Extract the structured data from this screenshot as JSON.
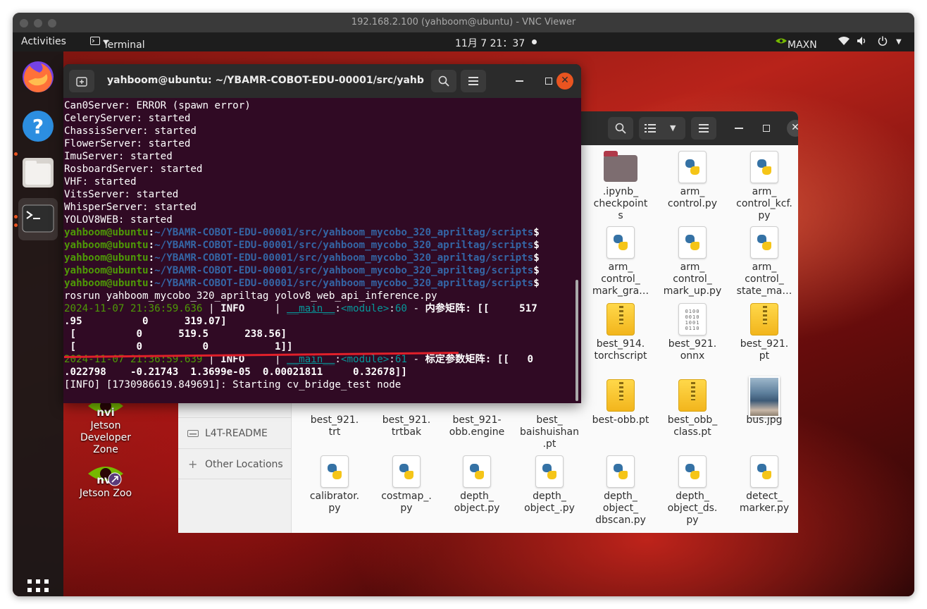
{
  "vnc": {
    "title": "192.168.2.100 (yahboom@ubuntu) - VNC Viewer"
  },
  "topbar": {
    "activities": "Activities",
    "app_name": "Terminal",
    "clock": "11月 7  21：37",
    "power_mode": "MAXN"
  },
  "desktop_icons": [
    {
      "label": "Jetson Developer Zone"
    },
    {
      "label": "Jetson Zoo"
    }
  ],
  "terminal": {
    "title": "yahboom@ubuntu: ~/YBAMR-COBOT-EDU-00001/src/yahboo...",
    "status_lines": [
      "Can0Server: ERROR (spawn error)",
      "CeleryServer: started",
      "ChassisServer: started",
      "FlowerServer: started",
      "ImuServer: started",
      "RosboardServer: started",
      "VHF: started",
      "VitsServer: started",
      "WhisperServer: started",
      "YOLOV8WEB: started"
    ],
    "prompt_user": "yahboom@ubuntu",
    "prompt_path": "~/YBAMR-COBOT-EDU-00001/src/yahboom_mycobo_320_apriltag/scripts",
    "command": "rosrun yahboom_mycobo_320_apriltag yolov8_web_api_inference.py",
    "log1_time": "2024-11-07 21:36:59.636",
    "log1_level": "INFO",
    "log1_module": "__main__",
    "log1_func": "<module>",
    "log1_line": "60",
    "log1_msg": "内参矩阵: [[     517",
    "matrix_rows": [
      ".95          0      319.07]",
      " [          0      519.5      238.56]",
      " [          0          0           1]]"
    ],
    "log2_time": "2024-11-07 21:36:59.639",
    "log2_level": "INFO",
    "log2_module": "__main__",
    "log2_func": "<module>",
    "log2_line": "61",
    "log2_msg": "标定参数矩阵: [[   0",
    "dist_row": ".022798    -0.21743  1.3699e-05  0.00021811     0.32678]]",
    "last_line": "[INFO] [1730986619.849691]: Starting cv_bridge_test node"
  },
  "files": {
    "sidebar": [
      {
        "icon": "drive-icon",
        "label": "L4T-README"
      },
      {
        "icon": "plus-icon",
        "label": "Other Locations"
      }
    ],
    "items": [
      {
        "name": ".ipynb_\ncheckpoint\ns",
        "icon": "folder-icon"
      },
      {
        "name": "arm_\ncontrol.py",
        "icon": "python-file-icon"
      },
      {
        "name": "arm_\ncontrol_kcf.\npy",
        "icon": "python-file-icon"
      },
      {
        "name": "arm_\ncontrol_\nmark_gra…",
        "icon": "python-file-icon"
      },
      {
        "name": "arm_\ncontrol_\nmark_up.py",
        "icon": "python-file-icon"
      },
      {
        "name": "arm_\ncontrol_\nstate_ma…",
        "icon": "python-file-icon"
      },
      {
        "name": "best_914.\ntorchscript",
        "icon": "archive-icon"
      },
      {
        "name": "best_921.\nonnx",
        "icon": "binary-file-icon"
      },
      {
        "name": "best_921.\npt",
        "icon": "archive-icon"
      },
      {
        "name": "best_921.\ntrt",
        "icon": "file-icon"
      },
      {
        "name": "best_921.\ntrtbak",
        "icon": "file-icon"
      },
      {
        "name": "best_921-\nobb.engine",
        "icon": "file-icon"
      },
      {
        "name": "best_\nbaishuishan\n.pt",
        "icon": "archive-icon"
      },
      {
        "name": "best-obb.pt",
        "icon": "archive-icon"
      },
      {
        "name": "best_obb_\nclass.pt",
        "icon": "archive-icon"
      },
      {
        "name": "bus.jpg",
        "icon": "image-file-icon"
      },
      {
        "name": "calibrator.\npy",
        "icon": "python-file-icon"
      },
      {
        "name": "costmap_.\npy",
        "icon": "python-file-icon"
      },
      {
        "name": "depth_\nobject.py",
        "icon": "python-file-icon"
      },
      {
        "name": "depth_\nobject_.py",
        "icon": "python-file-icon"
      },
      {
        "name": "depth_\nobject_\ndbscan.py",
        "icon": "python-file-icon"
      },
      {
        "name": "depth_\nobject_ds.\npy",
        "icon": "python-file-icon"
      },
      {
        "name": "detect_\nmarker.py",
        "icon": "python-file-icon"
      }
    ]
  },
  "colors": {
    "terminal_bg": "#300a24",
    "prompt_green": "#4e9a06",
    "prompt_blue": "#3465a4",
    "ubuntu_orange": "#e95420",
    "annotation_red": "#e0202a"
  }
}
